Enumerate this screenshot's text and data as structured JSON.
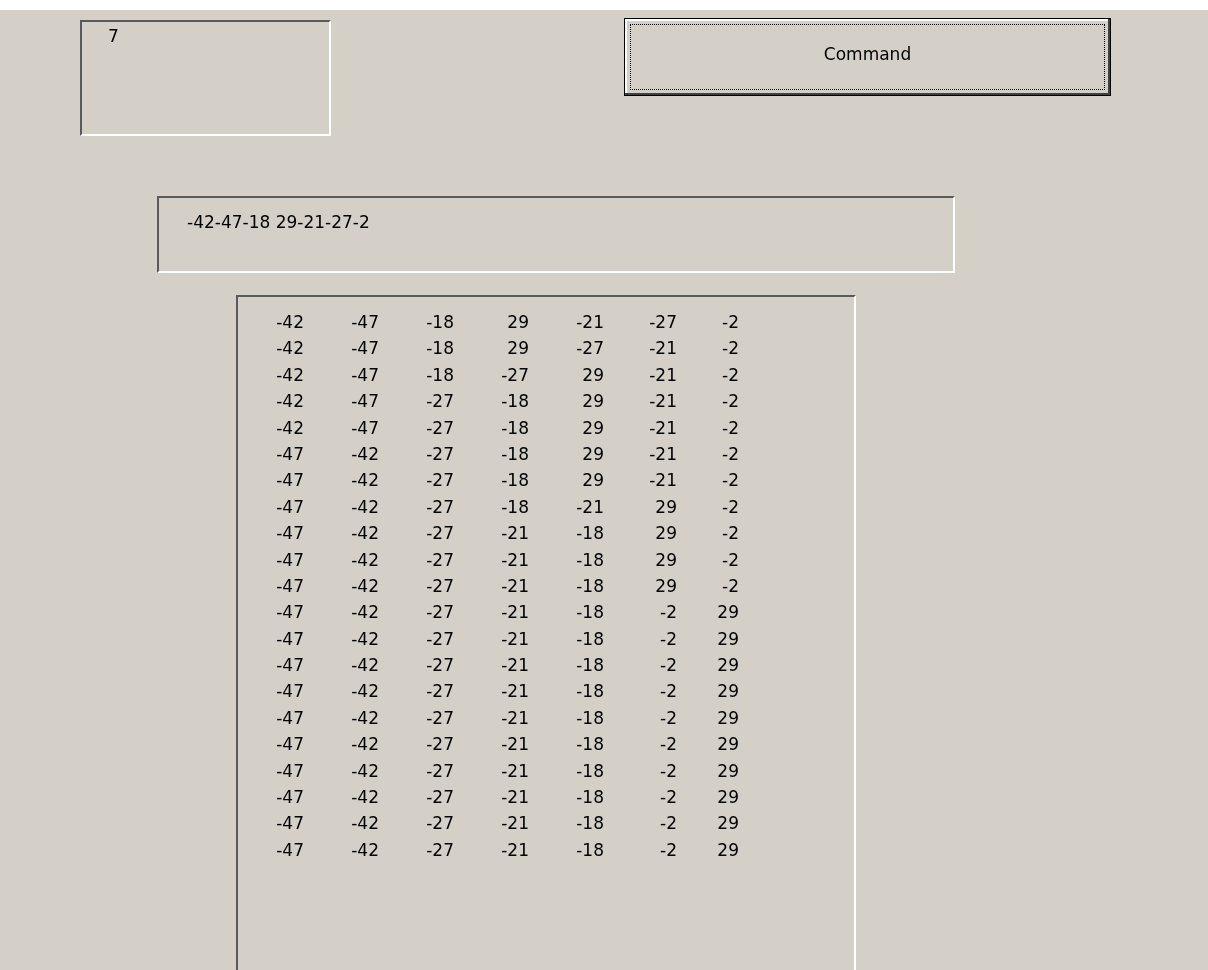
{
  "count_field": {
    "value": "7"
  },
  "command_button": {
    "label": "Command",
    "focused": true
  },
  "sequence_field": {
    "value": "-42-47-18 29-21-27-2"
  },
  "list_rows": [
    [
      "-42",
      "-47",
      "-18",
      "29",
      "-21",
      "-27",
      "-2"
    ],
    [
      "-42",
      "-47",
      "-18",
      "29",
      "-27",
      "-21",
      "-2"
    ],
    [
      "-42",
      "-47",
      "-18",
      "-27",
      "29",
      "-21",
      "-2"
    ],
    [
      "-42",
      "-47",
      "-27",
      "-18",
      "29",
      "-21",
      "-2"
    ],
    [
      "-42",
      "-47",
      "-27",
      "-18",
      "29",
      "-21",
      "-2"
    ],
    [
      "-47",
      "-42",
      "-27",
      "-18",
      "29",
      "-21",
      "-2"
    ],
    [
      "-47",
      "-42",
      "-27",
      "-18",
      "29",
      "-21",
      "-2"
    ],
    [
      "-47",
      "-42",
      "-27",
      "-18",
      "-21",
      "29",
      "-2"
    ],
    [
      "-47",
      "-42",
      "-27",
      "-21",
      "-18",
      "29",
      "-2"
    ],
    [
      "-47",
      "-42",
      "-27",
      "-21",
      "-18",
      "29",
      "-2"
    ],
    [
      "-47",
      "-42",
      "-27",
      "-21",
      "-18",
      "29",
      "-2"
    ],
    [
      "-47",
      "-42",
      "-27",
      "-21",
      "-18",
      "-2",
      "29"
    ],
    [
      "-47",
      "-42",
      "-27",
      "-21",
      "-18",
      "-2",
      "29"
    ],
    [
      "-47",
      "-42",
      "-27",
      "-21",
      "-18",
      "-2",
      "29"
    ],
    [
      "-47",
      "-42",
      "-27",
      "-21",
      "-18",
      "-2",
      "29"
    ],
    [
      "-47",
      "-42",
      "-27",
      "-21",
      "-18",
      "-2",
      "29"
    ],
    [
      "-47",
      "-42",
      "-27",
      "-21",
      "-18",
      "-2",
      "29"
    ],
    [
      "-47",
      "-42",
      "-27",
      "-21",
      "-18",
      "-2",
      "29"
    ],
    [
      "-47",
      "-42",
      "-27",
      "-21",
      "-18",
      "-2",
      "29"
    ],
    [
      "-47",
      "-42",
      "-27",
      "-21",
      "-18",
      "-2",
      "29"
    ],
    [
      "-47",
      "-42",
      "-27",
      "-21",
      "-18",
      "-2",
      "29"
    ]
  ]
}
